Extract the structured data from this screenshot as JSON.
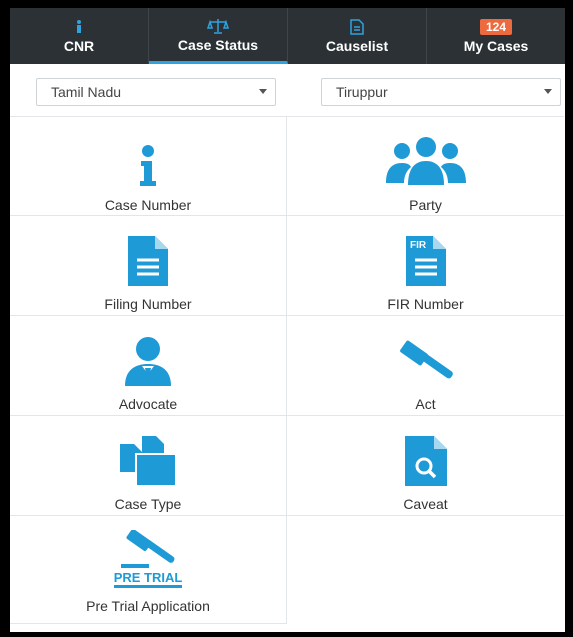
{
  "tabs": [
    {
      "label": "CNR",
      "icon": "info-icon"
    },
    {
      "label": "Case Status",
      "icon": "scales-icon",
      "active": true
    },
    {
      "label": "Causelist",
      "icon": "document-icon"
    },
    {
      "label": "My Cases",
      "badge": "124"
    }
  ],
  "selects": {
    "state": "Tamil Nadu",
    "district": "Tiruppur"
  },
  "options": [
    {
      "label": "Case Number",
      "icon": "info-icon"
    },
    {
      "label": "Party",
      "icon": "people-icon"
    },
    {
      "label": "Filing Number",
      "icon": "file-icon"
    },
    {
      "label": "FIR Number",
      "icon": "fir-file-icon"
    },
    {
      "label": "Advocate",
      "icon": "advocate-icon"
    },
    {
      "label": "Act",
      "icon": "gavel-icon"
    },
    {
      "label": "Case Type",
      "icon": "copy-files-icon"
    },
    {
      "label": "Caveat",
      "icon": "search-file-icon"
    },
    {
      "label": "Pre Trial Application",
      "icon": "pre-trial-gavel-icon",
      "icon_text": "PRE TRIAL"
    }
  ],
  "colors": {
    "accent": "#1e9ad6",
    "topbar": "#2b3135",
    "badge": "#ec6a3d"
  }
}
